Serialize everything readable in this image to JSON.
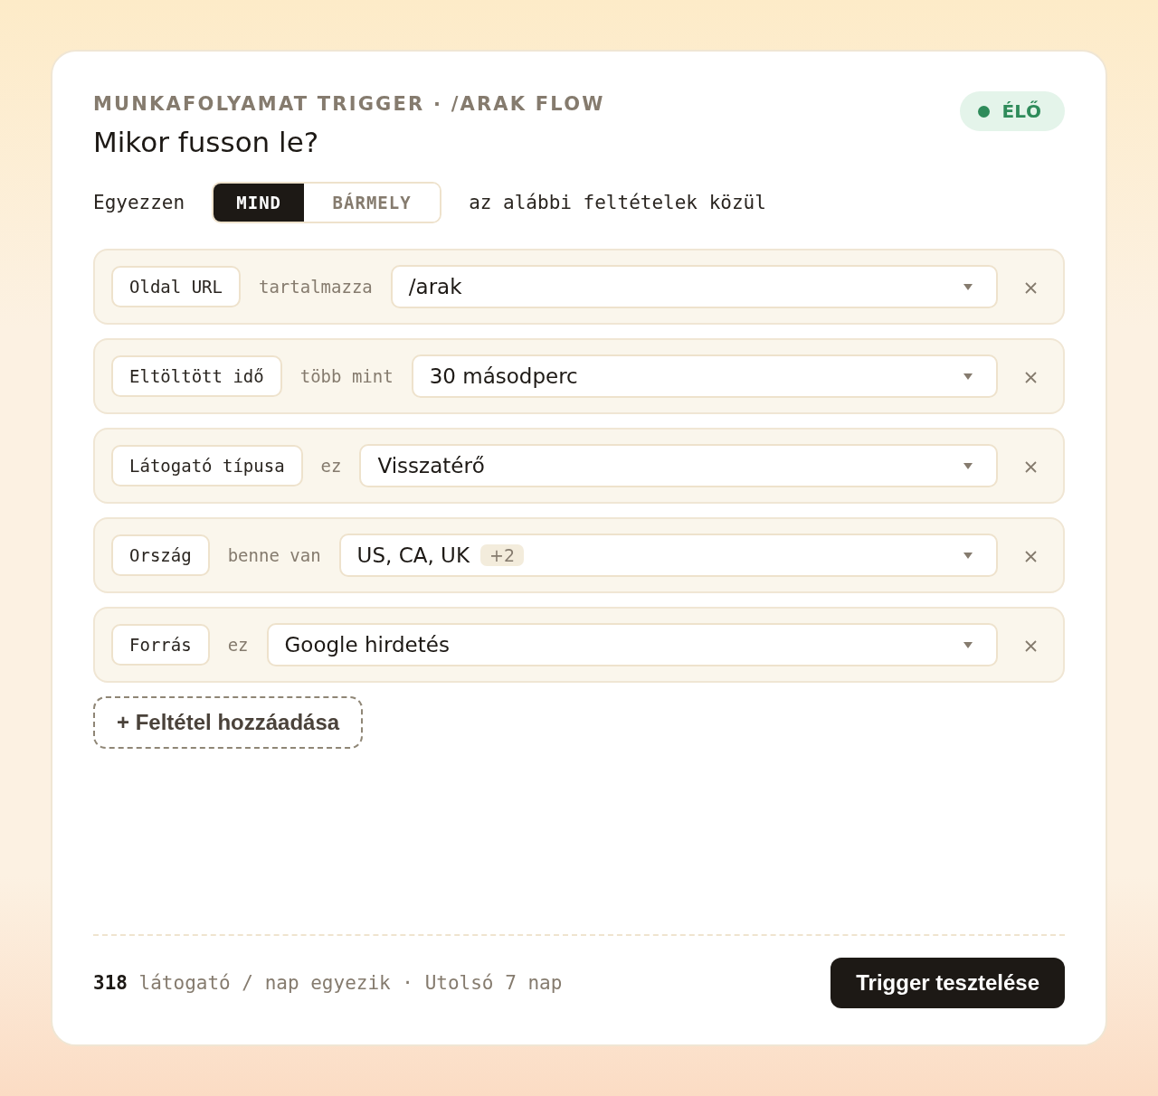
{
  "header": {
    "eyebrow": "MUNKAFOLYAMAT TRIGGER · /ARAK FLOW",
    "title": "Mikor fusson le?",
    "status": {
      "label": "ÉLŐ",
      "color": "#2e8b5a"
    }
  },
  "match": {
    "prefix": "Egyezzen",
    "options": [
      {
        "label": "MIND",
        "selected": true
      },
      {
        "label": "BÁRMELY",
        "selected": false
      }
    ],
    "suffix": "az alábbi feltételek közül"
  },
  "conditions": [
    {
      "field": "Oldal URL",
      "operator": "tartalmazza",
      "value": "/arak"
    },
    {
      "field": "Eltöltött idő",
      "operator": "több mint",
      "value": "30 másodperc"
    },
    {
      "field": "Látogató típusa",
      "operator": "ez",
      "value": "Visszatérő"
    },
    {
      "field": "Ország",
      "operator": "benne van",
      "value": "US, CA, UK",
      "extra": "+2"
    },
    {
      "field": "Forrás",
      "operator": "ez",
      "value": "Google hirdetés"
    }
  ],
  "add_button": "+ Feltétel hozzáadása",
  "footer": {
    "summary": "**318** látogató / nap egyezik · Utolsó 7 nap",
    "button": "Trigger tesztelése"
  }
}
